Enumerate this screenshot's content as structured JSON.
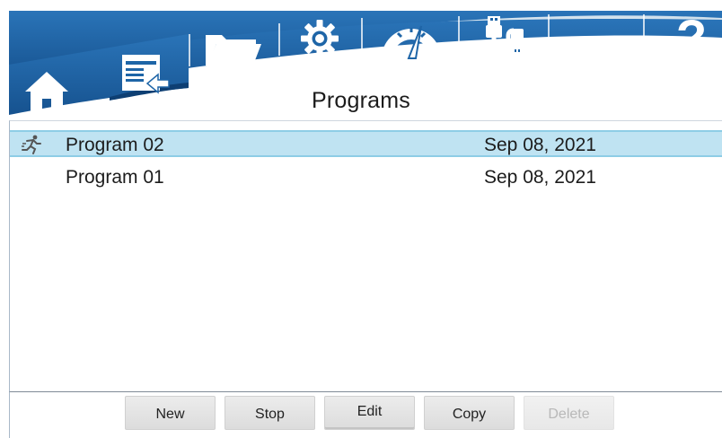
{
  "toolbar": {
    "items": [
      {
        "icon": "home-icon"
      },
      {
        "icon": "program-list-icon"
      },
      {
        "icon": "folder-icon"
      },
      {
        "icon": "gear-icon"
      },
      {
        "icon": "gauge-icon"
      },
      {
        "icon": "usb-cable-icon"
      },
      {
        "icon": "help-icon",
        "label": "?"
      }
    ]
  },
  "page": {
    "title": "Programs"
  },
  "programs": {
    "rows": [
      {
        "name": "Program 02",
        "date": "Sep 08, 2021",
        "selected": true,
        "status_icon": "running-man-icon"
      },
      {
        "name": "Program 01",
        "date": "Sep 08, 2021",
        "selected": false
      }
    ]
  },
  "buttons": {
    "new": "New",
    "stop": "Stop",
    "edit": "Edit",
    "copy": "Copy",
    "delete": "Delete"
  },
  "colors": {
    "header_blue": "#1e65a7",
    "header_light": "#d5e4ef",
    "selected_row": "#bfe3f2",
    "icon_white": "#ffffff"
  }
}
